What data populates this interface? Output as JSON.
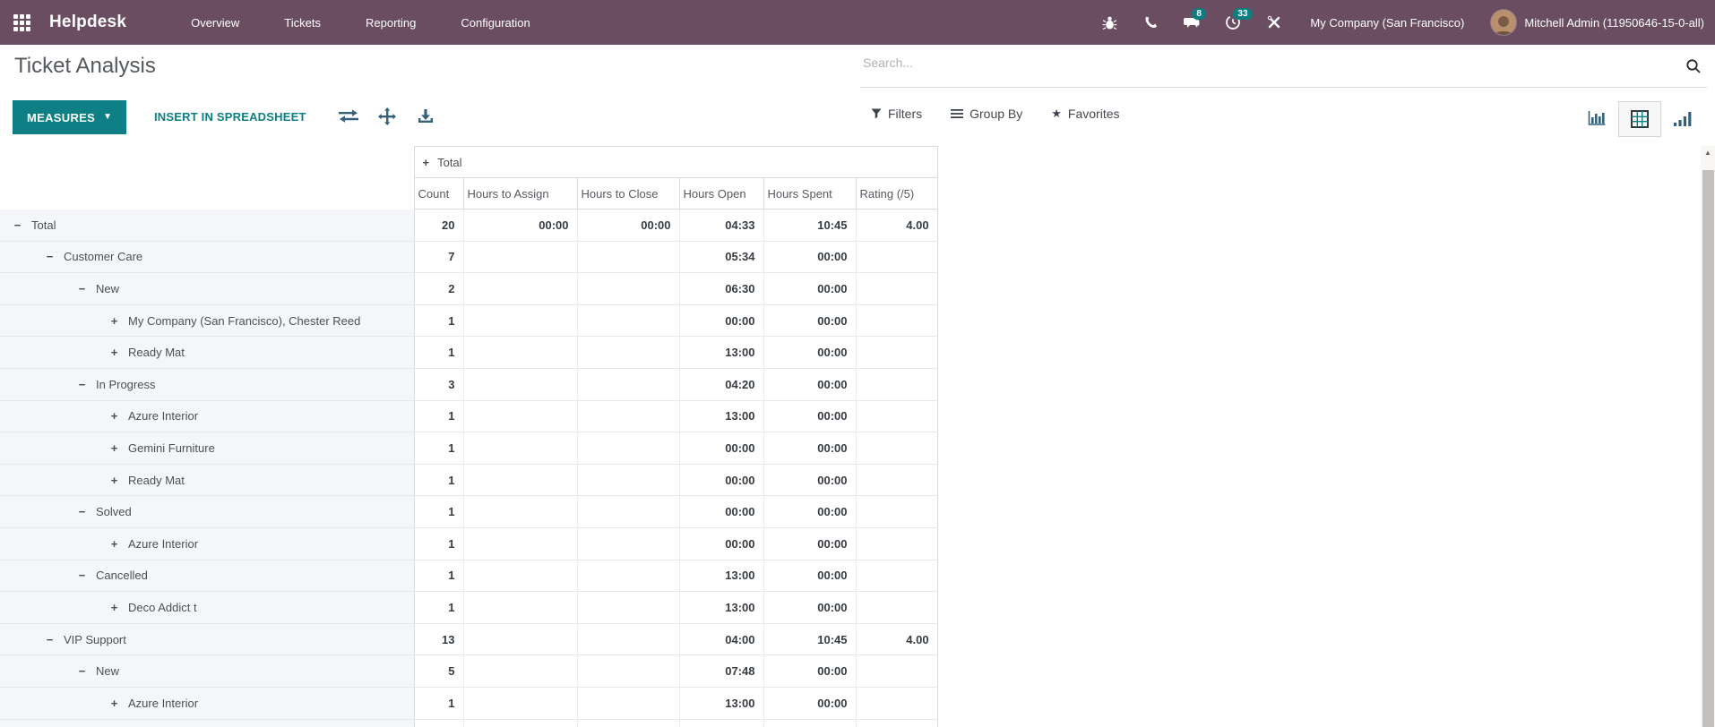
{
  "colors": {
    "topbar": "#6a4d61",
    "accent_teal": "#0e8085",
    "badge": "#0d7e80",
    "row_header_bg": "#f5f6fa"
  },
  "topbar": {
    "app_name": "Helpdesk",
    "menu": [
      "Overview",
      "Tickets",
      "Reporting",
      "Configuration"
    ],
    "badge_messages": "8",
    "badge_activities": "33",
    "company": "My Company (San Francisco)",
    "user": "Mitchell Admin (11950646-15-0-all)",
    "icons": [
      "apps-grid-icon",
      "bug-icon",
      "phone-icon",
      "chat-icon",
      "activity-clock-icon",
      "tools-icon"
    ]
  },
  "control_panel": {
    "title": "Ticket Analysis",
    "search_placeholder": "Search...",
    "measures_label": "MEASURES",
    "insert_label": "INSERT IN SPREADSHEET",
    "filters_label": "Filters",
    "group_by_label": "Group By",
    "favorites_label": "Favorites",
    "tool_icons": [
      "flip-axis-icon",
      "expand-all-icon",
      "download-icon"
    ],
    "view_switcher": [
      "dashboard-view",
      "pivot-view",
      "graph-view"
    ],
    "active_view": "pivot-view"
  },
  "pivot": {
    "col_group_header": "Total",
    "expanded_glyph": "−",
    "collapsed_glyph": "+",
    "columns": [
      "Count",
      "Hours to Assign",
      "Hours to Close",
      "Hours Open",
      "Hours Spent",
      "Rating (/5)"
    ],
    "rows": [
      {
        "label": "Total",
        "level": 0,
        "state": "expanded",
        "values": [
          "20",
          "00:00",
          "00:00",
          "04:33",
          "10:45",
          "4.00"
        ]
      },
      {
        "label": "Customer Care",
        "level": 1,
        "state": "expanded",
        "values": [
          "7",
          "",
          "",
          "05:34",
          "00:00",
          ""
        ]
      },
      {
        "label": "New",
        "level": 2,
        "state": "expanded",
        "values": [
          "2",
          "",
          "",
          "06:30",
          "00:00",
          ""
        ]
      },
      {
        "label": "My Company (San Francisco), Chester Reed",
        "level": 3,
        "state": "collapsed",
        "values": [
          "1",
          "",
          "",
          "00:00",
          "00:00",
          ""
        ]
      },
      {
        "label": "Ready Mat",
        "level": 3,
        "state": "collapsed",
        "values": [
          "1",
          "",
          "",
          "13:00",
          "00:00",
          ""
        ]
      },
      {
        "label": "In Progress",
        "level": 2,
        "state": "expanded",
        "values": [
          "3",
          "",
          "",
          "04:20",
          "00:00",
          ""
        ]
      },
      {
        "label": "Azure Interior",
        "level": 3,
        "state": "collapsed",
        "values": [
          "1",
          "",
          "",
          "13:00",
          "00:00",
          ""
        ]
      },
      {
        "label": "Gemini Furniture",
        "level": 3,
        "state": "collapsed",
        "values": [
          "1",
          "",
          "",
          "00:00",
          "00:00",
          ""
        ]
      },
      {
        "label": "Ready Mat",
        "level": 3,
        "state": "collapsed",
        "values": [
          "1",
          "",
          "",
          "00:00",
          "00:00",
          ""
        ]
      },
      {
        "label": "Solved",
        "level": 2,
        "state": "expanded",
        "values": [
          "1",
          "",
          "",
          "00:00",
          "00:00",
          ""
        ]
      },
      {
        "label": "Azure Interior",
        "level": 3,
        "state": "collapsed",
        "values": [
          "1",
          "",
          "",
          "00:00",
          "00:00",
          ""
        ]
      },
      {
        "label": "Cancelled",
        "level": 2,
        "state": "expanded",
        "values": [
          "1",
          "",
          "",
          "13:00",
          "00:00",
          ""
        ]
      },
      {
        "label": "Deco Addict t",
        "level": 3,
        "state": "collapsed",
        "values": [
          "1",
          "",
          "",
          "13:00",
          "00:00",
          ""
        ]
      },
      {
        "label": "VIP Support",
        "level": 1,
        "state": "expanded",
        "values": [
          "13",
          "",
          "",
          "04:00",
          "10:45",
          "4.00"
        ]
      },
      {
        "label": "New",
        "level": 2,
        "state": "expanded",
        "values": [
          "5",
          "",
          "",
          "07:48",
          "00:00",
          ""
        ]
      },
      {
        "label": "Azure Interior",
        "level": 3,
        "state": "collapsed",
        "values": [
          "1",
          "",
          "",
          "13:00",
          "00:00",
          ""
        ]
      }
    ]
  }
}
